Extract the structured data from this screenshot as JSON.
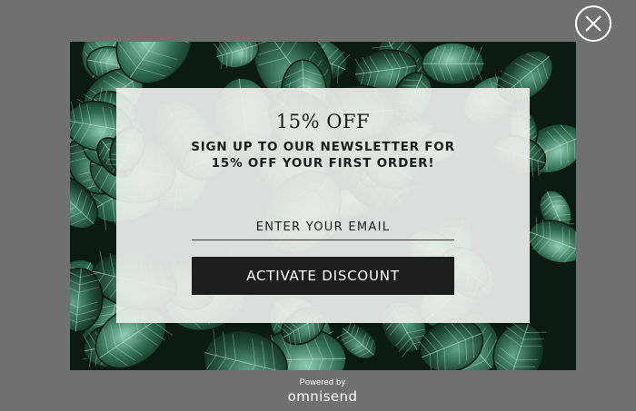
{
  "popup": {
    "headline": "15% OFF",
    "subhead_line1": "Sign up to our newsletter for",
    "subhead_line2": "15% off your first order!",
    "email_placeholder": "ENTER YOUR EMAIL",
    "button_label": "ACTIVATE DISCOUNT",
    "background_image": "dark-green-leaves",
    "accent_colors": {
      "overlay": "#6f706f",
      "panel": "#eceeec",
      "button": "#1e1e1e",
      "leaf_green": "#2f6a4f"
    }
  },
  "close": {
    "icon": "close-icon"
  },
  "footer": {
    "powered_by": "Powered by",
    "brand": "omnisend"
  }
}
